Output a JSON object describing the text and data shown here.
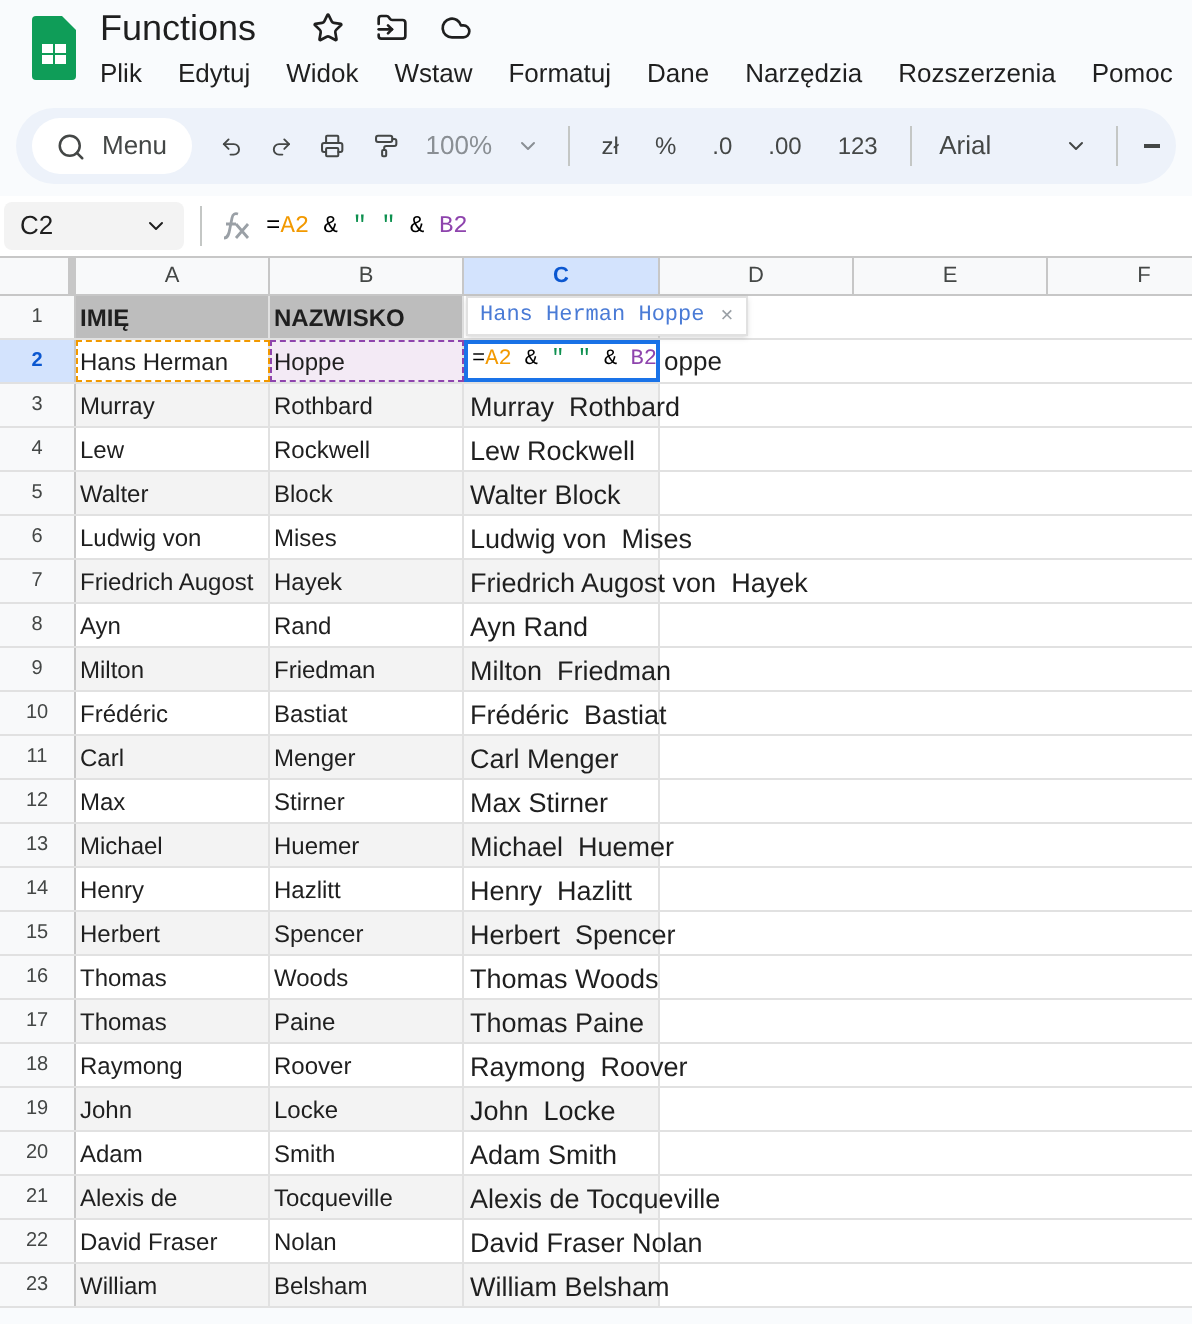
{
  "app": {
    "title": "Functions",
    "menu": [
      "Plik",
      "Edytuj",
      "Widok",
      "Wstaw",
      "Formatuj",
      "Dane",
      "Narzędzia",
      "Rozszerzenia",
      "Pomoc"
    ]
  },
  "toolbar": {
    "search": "Menu",
    "zoom": "100%",
    "zoom_disabled": true,
    "formats": [
      "zł",
      "%",
      ".0",
      ".00",
      "123"
    ],
    "font": "Arial"
  },
  "formula_bar": {
    "cell_ref": "C2",
    "parts": [
      {
        "text": "=",
        "color": "#000000"
      },
      {
        "text": "A2",
        "color": "#f29900"
      },
      {
        "text": " & ",
        "color": "#000000"
      },
      {
        "text": "\" \"",
        "color": "#0d904f"
      },
      {
        "text": " & ",
        "color": "#000000"
      },
      {
        "text": "B2",
        "color": "#8e44ad"
      }
    ]
  },
  "columns": [
    {
      "label": "A",
      "selected": false
    },
    {
      "label": "B",
      "selected": false
    },
    {
      "label": "C",
      "selected": true
    },
    {
      "label": "D",
      "selected": false
    },
    {
      "label": "E",
      "selected": false
    },
    {
      "label": "F",
      "selected": false
    }
  ],
  "preview": {
    "text": "Hans Herman Hoppe",
    "close": "×"
  },
  "rows": [
    {
      "number": "1",
      "kind": "header",
      "selected": false,
      "a": "IMIĘ",
      "b": "NAZWISKO"
    },
    {
      "number": "2",
      "kind": "editing",
      "selected": true,
      "a": "Hans Herman",
      "b": "Hoppe",
      "editor_parts": [
        {
          "text": "=",
          "color": "#000000"
        },
        {
          "text": "A2",
          "color": "#f29900"
        },
        {
          "text": " & ",
          "color": "#000000"
        },
        {
          "text": "\" \"",
          "color": "#0d904f"
        },
        {
          "text": " & ",
          "color": "#000000"
        },
        {
          "text": "B2",
          "color": "#8e44ad"
        }
      ],
      "overflow": "oppe"
    },
    {
      "number": "3",
      "kind": "data",
      "selected": false,
      "a": "Murray",
      "b": "Rothbard",
      "c": "Murray  Rothbard"
    },
    {
      "number": "4",
      "kind": "data",
      "selected": false,
      "a": "Lew",
      "b": "Rockwell",
      "c": "Lew Rockwell"
    },
    {
      "number": "5",
      "kind": "data",
      "selected": false,
      "a": "Walter",
      "b": "Block",
      "c": "Walter Block"
    },
    {
      "number": "6",
      "kind": "data",
      "selected": false,
      "a": "Ludwig von",
      "b": "Mises",
      "c": "Ludwig von  Mises"
    },
    {
      "number": "7",
      "kind": "data",
      "selected": false,
      "a": "Friedrich Augost",
      "b": "Hayek",
      "c": "Friedrich Augost von  Hayek"
    },
    {
      "number": "8",
      "kind": "data",
      "selected": false,
      "a": "Ayn",
      "b": "Rand",
      "c": "Ayn Rand"
    },
    {
      "number": "9",
      "kind": "data",
      "selected": false,
      "a": "Milton",
      "b": "Friedman",
      "c": "Milton  Friedman"
    },
    {
      "number": "10",
      "kind": "data",
      "selected": false,
      "a": "Frédéric",
      "b": "Bastiat",
      "c": "Frédéric  Bastiat"
    },
    {
      "number": "11",
      "kind": "data",
      "selected": false,
      "a": "Carl",
      "b": "Menger",
      "c": "Carl Menger"
    },
    {
      "number": "12",
      "kind": "data",
      "selected": false,
      "a": "Max",
      "b": "Stirner",
      "c": "Max Stirner"
    },
    {
      "number": "13",
      "kind": "data",
      "selected": false,
      "a": "Michael",
      "b": "Huemer",
      "c": "Michael  Huemer"
    },
    {
      "number": "14",
      "kind": "data",
      "selected": false,
      "a": "Henry",
      "b": "Hazlitt",
      "c": "Henry  Hazlitt"
    },
    {
      "number": "15",
      "kind": "data",
      "selected": false,
      "a": "Herbert",
      "b": "Spencer",
      "c": "Herbert  Spencer"
    },
    {
      "number": "16",
      "kind": "data",
      "selected": false,
      "a": "Thomas",
      "b": "Woods",
      "c": "Thomas Woods"
    },
    {
      "number": "17",
      "kind": "data",
      "selected": false,
      "a": "Thomas",
      "b": "Paine",
      "c": "Thomas Paine"
    },
    {
      "number": "18",
      "kind": "data",
      "selected": false,
      "a": "Raymong",
      "b": "Roover",
      "c": "Raymong  Roover"
    },
    {
      "number": "19",
      "kind": "data",
      "selected": false,
      "a": "John",
      "b": "Locke",
      "c": "John  Locke"
    },
    {
      "number": "20",
      "kind": "data",
      "selected": false,
      "a": "Adam",
      "b": "Smith",
      "c": "Adam Smith"
    },
    {
      "number": "21",
      "kind": "data",
      "selected": false,
      "a": "Alexis de",
      "b": "Tocqueville",
      "c": "Alexis de Tocqueville"
    },
    {
      "number": "22",
      "kind": "data",
      "selected": false,
      "a": "David Fraser",
      "b": "Nolan",
      "c": "David Fraser Nolan"
    },
    {
      "number": "23",
      "kind": "data",
      "selected": false,
      "a": "William",
      "b": "Belsham",
      "c": "William Belsham"
    }
  ]
}
